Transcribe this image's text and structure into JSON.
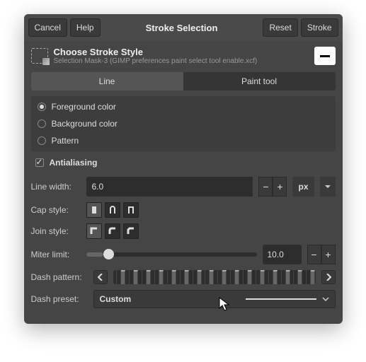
{
  "titlebar": {
    "cancel": "Cancel",
    "help": "Help",
    "title": "Stroke Selection",
    "reset": "Reset",
    "stroke": "Stroke"
  },
  "header": {
    "heading": "Choose Stroke Style",
    "sub": "Selection Mask-3 (GIMP preferences paint select tool enable.xcf)"
  },
  "tabs": {
    "line": "Line",
    "paint": "Paint tool",
    "active": 0
  },
  "radios": {
    "fg": "Foreground color",
    "bg": "Background color",
    "pattern": "Pattern",
    "selected": "fg"
  },
  "antialias": {
    "label": "Antialiasing",
    "checked": true
  },
  "linewidth": {
    "label": "Line width:",
    "value": "6.0",
    "unit": "px"
  },
  "cap": {
    "label": "Cap style:"
  },
  "join": {
    "label": "Join style:"
  },
  "miter": {
    "label": "Miter limit:",
    "value": "10.0"
  },
  "dashpattern": {
    "label": "Dash pattern:"
  },
  "dashpreset": {
    "label": "Dash preset:",
    "value": "Custom"
  }
}
